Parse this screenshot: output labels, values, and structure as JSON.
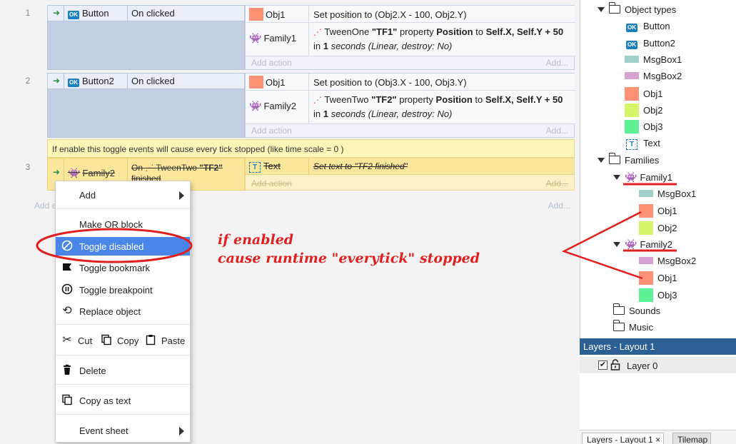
{
  "events": [
    {
      "number": "1",
      "condition": {
        "object": "Button",
        "text": "On clicked"
      },
      "actions": [
        {
          "object": "Obj1",
          "text": "Set position to (Obj2.X - 100, Obj2.Y)"
        },
        {
          "object": "Family1",
          "line1_prefix": "TweenOne ",
          "line1_bold1": "\"TF1\"",
          "line1_mid": " property ",
          "line1_bold2": "Position",
          "line1_mid2": " to ",
          "line1_bold3": "Self.X, Self.Y + 50",
          "line2_prefix": "in ",
          "line2_bold": "1",
          "line2_suffix": " seconds (Linear, destroy: No)"
        }
      ]
    },
    {
      "number": "2",
      "condition": {
        "object": "Button2",
        "text": "On clicked"
      },
      "actions": [
        {
          "object": "Obj1",
          "text": "Set position to (Obj3.X - 100, Obj3.Y)"
        },
        {
          "object": "Family2",
          "line1_prefix": "TweenTwo ",
          "line1_bold1": "\"TF2\"",
          "line1_mid": " property ",
          "line1_bold2": "Position",
          "line1_mid2": " to ",
          "line1_bold3": "Self.X, Self.Y + 50",
          "line2_prefix": "in ",
          "line2_bold": "1",
          "line2_suffix": " seconds (Linear, destroy: No)"
        }
      ]
    }
  ],
  "add_action": "Add action",
  "add_dots": "Add...",
  "comment": "If enable this toggle events will cause every tick stopped (like time scale = 0 )",
  "event3": {
    "number": "3",
    "condition_object": "Family2",
    "condition_text_a": "On ",
    "condition_text_b": "TweenTwo ",
    "condition_text_c": "\"TF2\"",
    "condition_text_d": "finished",
    "action_object": "Text",
    "action_text": "Set text to \"TF2 finished\""
  },
  "add_event": "Add e",
  "context_menu": {
    "add": "Add",
    "make_or_block": "Make OR block",
    "toggle_disabled": "Toggle disabled",
    "toggle_bookmark": "Toggle bookmark",
    "toggle_breakpoint": "Toggle breakpoint",
    "replace_object": "Replace object",
    "cut": "Cut",
    "copy": "Copy",
    "paste": "Paste",
    "delete": "Delete",
    "copy_as_text": "Copy as text",
    "event_sheet": "Event sheet"
  },
  "annotation": {
    "line1": "if enabled",
    "line2": "cause runtime \"everytick\" stopped",
    "color": "#e02020"
  },
  "project_tree": {
    "object_types_label": "Object types",
    "object_types": [
      {
        "name": "Button",
        "icon": "button-icon"
      },
      {
        "name": "Button2",
        "icon": "button-icon"
      },
      {
        "name": "MsgBox1",
        "color": "#9fd1c9"
      },
      {
        "name": "MsgBox2",
        "color": "#d6a3d2"
      },
      {
        "name": "Obj1",
        "color": "#ff9174"
      },
      {
        "name": "Obj2",
        "color": "#d6f56a"
      },
      {
        "name": "Obj3",
        "color": "#5cf295"
      },
      {
        "name": "Text",
        "icon": "text-icon"
      }
    ],
    "families_label": "Families",
    "families": [
      {
        "name": "Family1",
        "members": [
          {
            "name": "MsgBox1",
            "color": "#9fd1c9"
          },
          {
            "name": "Obj1",
            "color": "#ff9174"
          },
          {
            "name": "Obj2",
            "color": "#d6f56a"
          }
        ]
      },
      {
        "name": "Family2",
        "members": [
          {
            "name": "MsgBox2",
            "color": "#d6a3d2"
          },
          {
            "name": "Obj1",
            "color": "#ff9174"
          },
          {
            "name": "Obj3",
            "color": "#5cf295"
          }
        ]
      }
    ],
    "sounds_label": "Sounds",
    "music_label": "Music"
  },
  "layers": {
    "header": "Layers - Layout 1",
    "layer0": "Layer 0"
  },
  "bottom_tabs": {
    "layers_tab": "Layers - Layout 1",
    "close_glyph": "×",
    "tilemap_tab": "Tilemap"
  }
}
